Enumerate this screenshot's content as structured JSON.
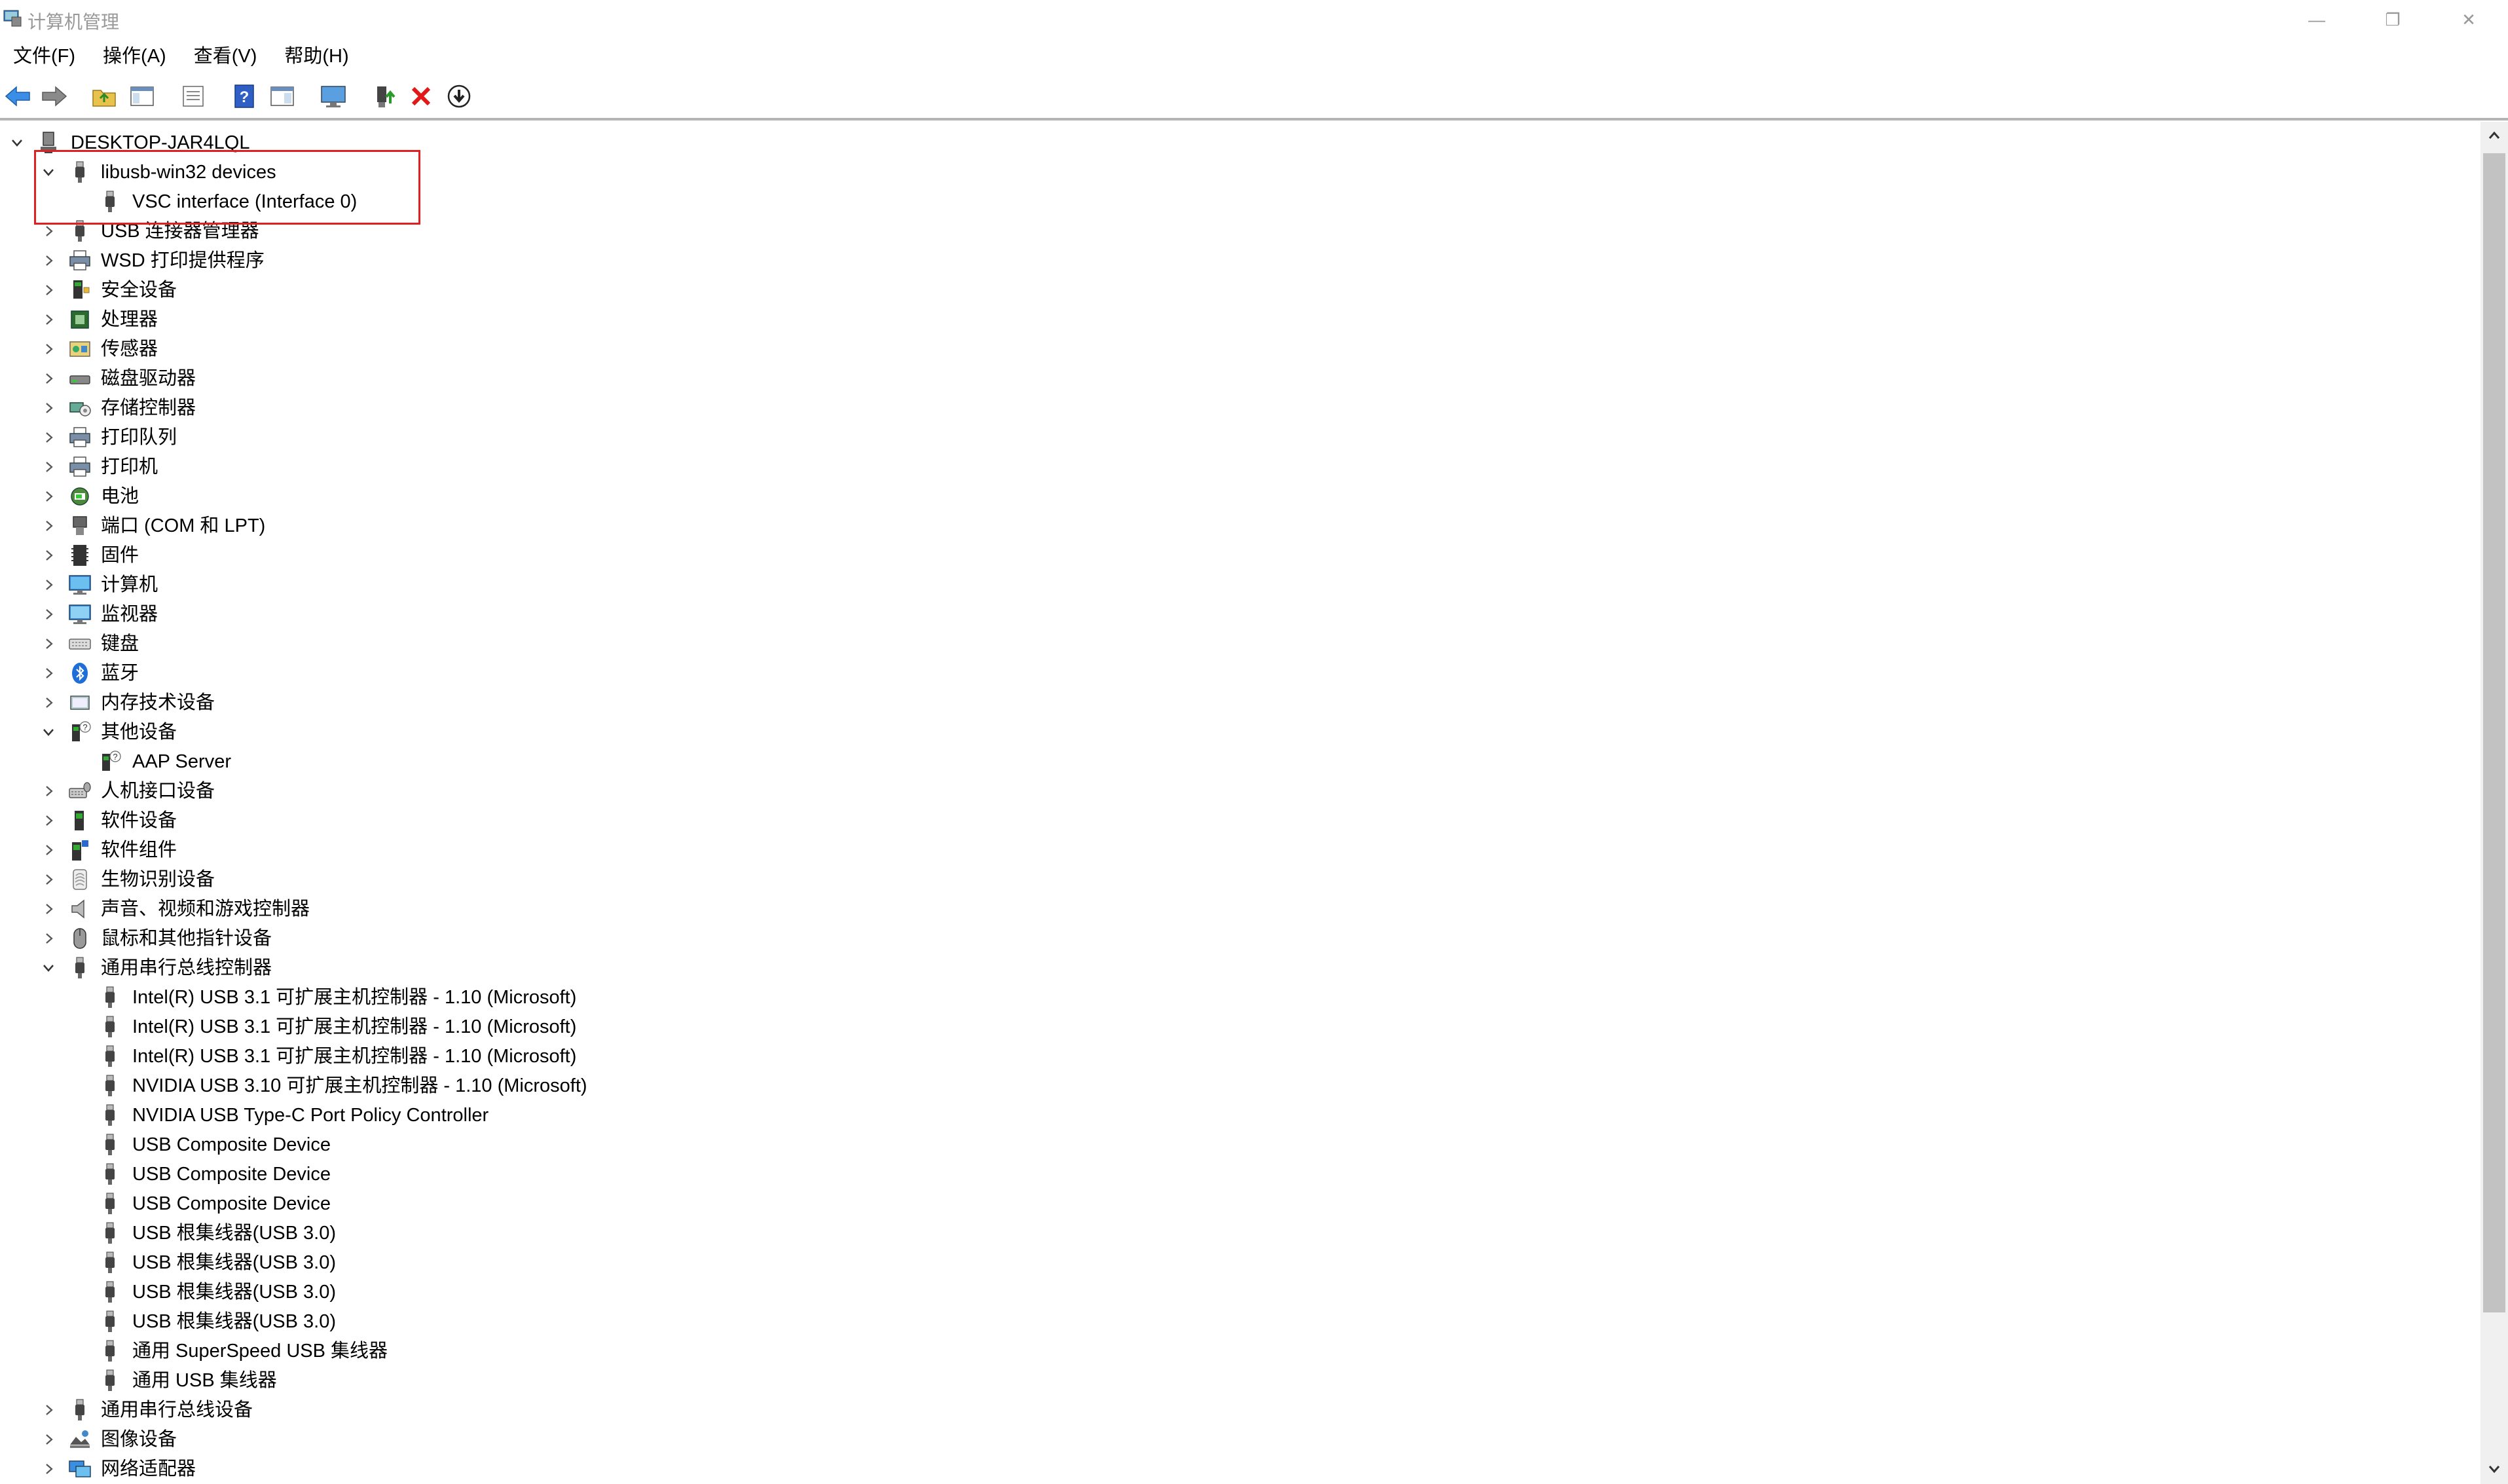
{
  "window": {
    "title": "计算机管理",
    "minimize": "—",
    "restore": "❐",
    "close": "✕"
  },
  "menu": [
    "文件(F)",
    "操作(A)",
    "查看(V)",
    "帮助(H)"
  ],
  "toolbar": [
    {
      "name": "back-icon"
    },
    {
      "name": "forward-icon"
    },
    {
      "name": "up-folder-icon"
    },
    {
      "name": "show-hide-tree-icon"
    },
    {
      "name": "properties-icon"
    },
    {
      "name": "help-icon"
    },
    {
      "name": "show-pane-icon"
    },
    {
      "name": "monitor-icon"
    },
    {
      "name": "update-driver-icon"
    },
    {
      "name": "uninstall-icon"
    },
    {
      "name": "scan-download-icon"
    }
  ],
  "tree": {
    "root": "DESKTOP-JAR4LQL",
    "items": [
      {
        "label": "libusb-win32 devices",
        "level": 1,
        "expanded": true,
        "icon": "usb-plug-icon"
      },
      {
        "label": "VSC interface (Interface 0)",
        "level": 2,
        "icon": "usb-plug-icon"
      },
      {
        "label": "USB 连接器管理器",
        "level": 1,
        "expanded": false,
        "icon": "usb-plug-icon"
      },
      {
        "label": "WSD 打印提供程序",
        "level": 1,
        "expanded": false,
        "icon": "printer-icon"
      },
      {
        "label": "安全设备",
        "level": 1,
        "expanded": false,
        "icon": "security-device-icon"
      },
      {
        "label": "处理器",
        "level": 1,
        "expanded": false,
        "icon": "processor-icon"
      },
      {
        "label": "传感器",
        "level": 1,
        "expanded": false,
        "icon": "sensor-icon"
      },
      {
        "label": "磁盘驱动器",
        "level": 1,
        "expanded": false,
        "icon": "disk-drive-icon"
      },
      {
        "label": "存储控制器",
        "level": 1,
        "expanded": false,
        "icon": "storage-controller-icon"
      },
      {
        "label": "打印队列",
        "level": 1,
        "expanded": false,
        "icon": "printer-icon"
      },
      {
        "label": "打印机",
        "level": 1,
        "expanded": false,
        "icon": "printer-icon"
      },
      {
        "label": "电池",
        "level": 1,
        "expanded": false,
        "icon": "battery-icon"
      },
      {
        "label": "端口 (COM 和 LPT)",
        "level": 1,
        "expanded": false,
        "icon": "port-icon"
      },
      {
        "label": "固件",
        "level": 1,
        "expanded": false,
        "icon": "firmware-icon"
      },
      {
        "label": "计算机",
        "level": 1,
        "expanded": false,
        "icon": "computer-icon"
      },
      {
        "label": "监视器",
        "level": 1,
        "expanded": false,
        "icon": "monitor-icon"
      },
      {
        "label": "键盘",
        "level": 1,
        "expanded": false,
        "icon": "keyboard-icon"
      },
      {
        "label": "蓝牙",
        "level": 1,
        "expanded": false,
        "icon": "bluetooth-icon"
      },
      {
        "label": "内存技术设备",
        "level": 1,
        "expanded": false,
        "icon": "memory-device-icon"
      },
      {
        "label": "其他设备",
        "level": 1,
        "expanded": true,
        "icon": "unknown-device-icon"
      },
      {
        "label": "AAP Server",
        "level": 2,
        "icon": "unknown-device-icon"
      },
      {
        "label": "人机接口设备",
        "level": 1,
        "expanded": false,
        "icon": "hid-icon"
      },
      {
        "label": "软件设备",
        "level": 1,
        "expanded": false,
        "icon": "software-device-icon"
      },
      {
        "label": "软件组件",
        "level": 1,
        "expanded": false,
        "icon": "software-component-icon"
      },
      {
        "label": "生物识别设备",
        "level": 1,
        "expanded": false,
        "icon": "fingerprint-icon"
      },
      {
        "label": "声音、视频和游戏控制器",
        "level": 1,
        "expanded": false,
        "icon": "speaker-icon"
      },
      {
        "label": "鼠标和其他指针设备",
        "level": 1,
        "expanded": false,
        "icon": "mouse-icon"
      },
      {
        "label": "通用串行总线控制器",
        "level": 1,
        "expanded": true,
        "icon": "usb-plug-icon"
      },
      {
        "label": "Intel(R) USB 3.1 可扩展主机控制器 - 1.10 (Microsoft)",
        "level": 2,
        "icon": "usb-plug-icon"
      },
      {
        "label": "Intel(R) USB 3.1 可扩展主机控制器 - 1.10 (Microsoft)",
        "level": 2,
        "icon": "usb-plug-icon"
      },
      {
        "label": "Intel(R) USB 3.1 可扩展主机控制器 - 1.10 (Microsoft)",
        "level": 2,
        "icon": "usb-plug-icon"
      },
      {
        "label": "NVIDIA USB 3.10 可扩展主机控制器 - 1.10 (Microsoft)",
        "level": 2,
        "icon": "usb-plug-icon"
      },
      {
        "label": "NVIDIA USB Type-C Port Policy Controller",
        "level": 2,
        "icon": "usb-plug-icon"
      },
      {
        "label": "USB Composite Device",
        "level": 2,
        "icon": "usb-plug-icon"
      },
      {
        "label": "USB Composite Device",
        "level": 2,
        "icon": "usb-plug-icon"
      },
      {
        "label": "USB Composite Device",
        "level": 2,
        "icon": "usb-plug-icon"
      },
      {
        "label": "USB 根集线器(USB 3.0)",
        "level": 2,
        "icon": "usb-plug-icon"
      },
      {
        "label": "USB 根集线器(USB 3.0)",
        "level": 2,
        "icon": "usb-plug-icon"
      },
      {
        "label": "USB 根集线器(USB 3.0)",
        "level": 2,
        "icon": "usb-plug-icon"
      },
      {
        "label": "USB 根集线器(USB 3.0)",
        "level": 2,
        "icon": "usb-plug-icon"
      },
      {
        "label": "通用 SuperSpeed USB 集线器",
        "level": 2,
        "icon": "usb-plug-icon"
      },
      {
        "label": "通用 USB 集线器",
        "level": 2,
        "icon": "usb-plug-icon"
      },
      {
        "label": "通用串行总线设备",
        "level": 1,
        "expanded": false,
        "icon": "usb-plug-icon"
      },
      {
        "label": "图像设备",
        "level": 1,
        "expanded": false,
        "icon": "camera-icon"
      },
      {
        "label": "网络适配器",
        "level": 1,
        "expanded": false,
        "icon": "network-adapter-icon"
      }
    ]
  },
  "colors": {
    "highlight_box": "#e02020",
    "scrollbar_thumb": "#c2c2c2",
    "toolbar_border": "#b4b4b4"
  }
}
